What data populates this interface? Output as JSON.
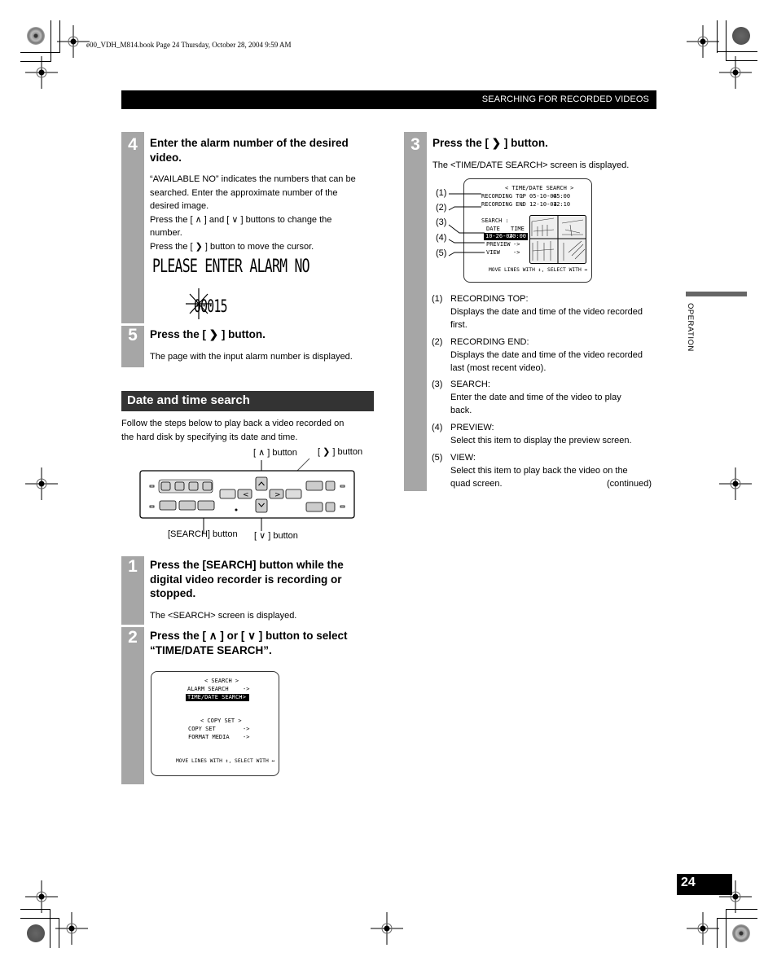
{
  "print_info": "e00_VDH_M814.book  Page 24  Thursday, October 28, 2004  9:59 AM",
  "header": {
    "title": "SEARCHING FOR RECORDED VIDEOS"
  },
  "side_tab": {
    "label": "OPERATION"
  },
  "page_number": "24",
  "left_column": {
    "step4": {
      "number": "4",
      "title": "Enter the alarm number of the desired video.",
      "lines": [
        "“AVAILABLE NO” indicates the numbers that can be",
        "searched. Enter the approximate number of the",
        "desired image.",
        "Press the [ ∧ ] and [ ∨ ] buttons to change the",
        "number.",
        "Press the [ ❯ ] button to move the cursor."
      ],
      "display": {
        "prompt": "PLEASE ENTER ALARM NO",
        "value": "00015"
      }
    },
    "step5": {
      "number": "5",
      "title": "Press the [ ❯ ] button.",
      "text": "The page with the input alarm number is displayed."
    },
    "section": {
      "title": "Date and time search",
      "intro_lines": [
        "Follow the steps below to play back a video recorded on",
        "the hard disk by specifying its date and time."
      ]
    },
    "panel_callouts": {
      "up": "[ ∧ ] button",
      "right": "[ ❯ ] button",
      "search": "[SEARCH] button",
      "down": "[ ∨ ] button"
    },
    "step1": {
      "number": "1",
      "title_lines": [
        "Press the [SEARCH] button while the",
        "digital video recorder is recording or",
        "stopped."
      ],
      "text": "The <SEARCH> screen is displayed."
    },
    "step2": {
      "number": "2",
      "title_lines": [
        "Press the [ ∧ ] or [ ∨ ] button to select",
        "“TIME/DATE SEARCH”."
      ]
    },
    "search_screen": {
      "heading": "< SEARCH >",
      "items": [
        {
          "label": "ALARM SEARCH",
          "arrow": "->",
          "selected": false
        },
        {
          "label": "TIME/DATE SEARCH",
          "arrow": "->",
          "selected": true
        }
      ],
      "copy_heading": "< COPY SET >",
      "copy_items": [
        {
          "label": "COPY SET",
          "arrow": "->"
        },
        {
          "label": "FORMAT MEDIA",
          "arrow": "->"
        }
      ],
      "footer": "MOVE LINES WITH ↕, SELECT WITH ↔"
    }
  },
  "right_column": {
    "step3": {
      "number": "3",
      "title": "Press the [ ❯ ] button.",
      "text": "The <TIME/DATE SEARCH> screen is displayed."
    },
    "time_date_screen": {
      "heading": "< TIME/DATE SEARCH >",
      "recording_top": {
        "label": "RECORDING TOP",
        "sep": ":",
        "date": "05-10-04",
        "time": "05:00"
      },
      "recording_end": {
        "label": "RECORDING END",
        "sep": ":",
        "date": "12-10-04",
        "time": "12:10"
      },
      "search_label": "SEARCH :",
      "date_header": "DATE",
      "time_header": "TIME",
      "search_date": "10-26-04",
      "search_time": "20:00",
      "preview": {
        "label": "PREVIEW",
        "arrow": "->"
      },
      "view": {
        "label": "VIEW",
        "arrow": "->"
      },
      "footer": "MOVE LINES WITH ↕, SELECT WITH ↔"
    },
    "callout_markers": [
      "(1)",
      "(2)",
      "(3)",
      "(4)",
      "(5)"
    ],
    "descriptions": [
      {
        "n": "(1)",
        "title": "RECORDING TOP:",
        "lines": [
          "Displays the date and time of the video recorded",
          "first."
        ]
      },
      {
        "n": "(2)",
        "title": "RECORDING END:",
        "lines": [
          "Displays the date and time of the video recorded",
          "last (most recent video)."
        ]
      },
      {
        "n": "(3)",
        "title": "SEARCH:",
        "lines": [
          "Enter the date and time of the video to play",
          "back."
        ]
      },
      {
        "n": "(4)",
        "title": "PREVIEW:",
        "lines": [
          "Select this item to display the preview screen."
        ]
      },
      {
        "n": "(5)",
        "title": "VIEW:",
        "lines": [
          "Select this item to play back the video on the",
          "quad screen."
        ]
      }
    ],
    "continued": "(continued)"
  }
}
